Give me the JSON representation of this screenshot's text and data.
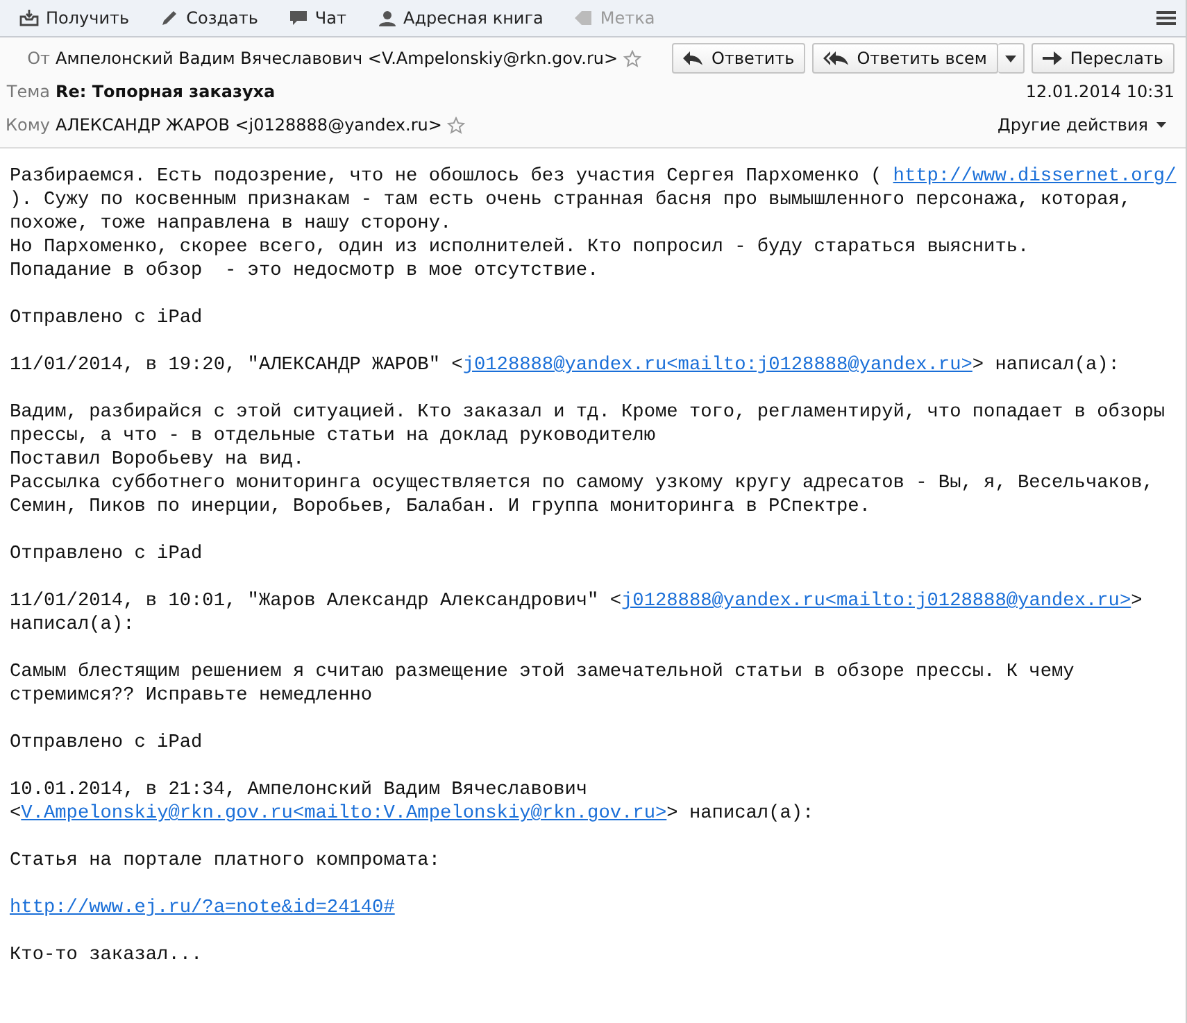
{
  "toolbar": [
    {
      "label": "Получить",
      "kind": "inbox",
      "disabled": false
    },
    {
      "label": "Создать",
      "kind": "pencil",
      "disabled": false
    },
    {
      "label": "Чат",
      "kind": "chat",
      "disabled": false
    },
    {
      "label": "Адресная книга",
      "kind": "person",
      "disabled": false
    },
    {
      "label": "Метка",
      "kind": "tag",
      "disabled": true
    }
  ],
  "header": {
    "fields": [
      {
        "label": "От",
        "value": "Ампелонский Вадим Вячеславович <V.Ampelonskiy@rkn.gov.ru>",
        "kind": "address",
        "bold": false
      },
      {
        "label": "Тема",
        "value": "Re: Топорная заказуха",
        "kind": "subject",
        "bold": true
      },
      {
        "label": "Кому",
        "value": "АЛЕКСАНДР ЖАРОВ <j0128888@yandex.ru>",
        "kind": "address",
        "bold": false
      }
    ],
    "buttons": [
      {
        "label": "Ответить",
        "kind": "reply",
        "dropdown": false
      },
      {
        "label": "Ответить всем",
        "kind": "reply-all",
        "dropdown": true
      },
      {
        "label": "Переслать",
        "kind": "forward",
        "dropdown": false
      }
    ],
    "date": "12.01.2014 10:31",
    "more_actions": "Другие действия"
  },
  "body": [
    [
      [
        {
          "kind": "text",
          "text": "Разбираемся. Есть подозрение, что не обошлось без участия Сергея Пархоменко ( "
        },
        {
          "kind": "link",
          "text": "http://www.dissernet.org/"
        }
      ],
      [
        {
          "kind": "text",
          "text": "). Сужу по косвенным признакам - там есть очень странная басня про вымышленного персонажа, которая,"
        }
      ],
      [
        {
          "kind": "text",
          "text": "похоже, тоже направлена в нашу сторону."
        }
      ],
      [
        {
          "kind": "text",
          "text": "Но Пархоменко, скорее всего, один из исполнителей. Кто попросил - буду стараться выяснить."
        }
      ],
      [
        {
          "kind": "text",
          "text": "Попадание в обзор  - это недосмотр в мое отсутствие."
        }
      ]
    ],
    [
      [
        {
          "kind": "text",
          "text": "Отправлено с iPad"
        }
      ]
    ],
    [
      [
        {
          "kind": "text",
          "text": "11/01/2014, в 19:20, \"АЛЕКСАНДР ЖАРОВ\" <"
        },
        {
          "kind": "link",
          "text": "j0128888@yandex.ru<mailto:j0128888@yandex.ru>"
        },
        {
          "kind": "text",
          "text": "> написал(а):"
        }
      ]
    ],
    [
      [
        {
          "kind": "text",
          "text": "Вадим, разбирайся с этой ситуацией. Кто заказал и тд. Кроме того, регламентируй, что попадает в обзоры"
        }
      ],
      [
        {
          "kind": "text",
          "text": "прессы, а что - в отдельные статьи на доклад руководителю"
        }
      ],
      [
        {
          "kind": "text",
          "text": "Поставил Воробьеву на вид."
        }
      ],
      [
        {
          "kind": "text",
          "text": "Рассылка субботнего мониторинга осуществляется по самому узкому кругу адресатов - Вы, я, Весельчаков,"
        }
      ],
      [
        {
          "kind": "text",
          "text": "Семин, Пиков по инерции, Воробьев, Балабан. И группа мониторинга в РСпектре."
        }
      ]
    ],
    [
      [
        {
          "kind": "text",
          "text": "Отправлено с iPad"
        }
      ]
    ],
    [
      [
        {
          "kind": "text",
          "text": "11/01/2014, в 10:01, \"Жаров Александр Александрович\" <"
        },
        {
          "kind": "link",
          "text": "j0128888@yandex.ru<mailto:j0128888@yandex.ru>"
        },
        {
          "kind": "text",
          "text": ">"
        }
      ],
      [
        {
          "kind": "text",
          "text": "написал(а):"
        }
      ]
    ],
    [
      [
        {
          "kind": "text",
          "text": "Самым блестящим решением я считаю размещение этой замечательной статьи в обзоре прессы. К чему"
        }
      ],
      [
        {
          "kind": "text",
          "text": "стремимся?? Исправьте немедленно"
        }
      ]
    ],
    [
      [
        {
          "kind": "text",
          "text": "Отправлено с iPad"
        }
      ]
    ],
    [
      [
        {
          "kind": "text",
          "text": "10.01.2014, в 21:34, Ампелонский Вадим Вячеславович"
        }
      ],
      [
        {
          "kind": "text",
          "text": "<"
        },
        {
          "kind": "link",
          "text": "V.Ampelonskiy@rkn.gov.ru<mailto:V.Ampelonskiy@rkn.gov.ru>"
        },
        {
          "kind": "text",
          "text": "> написал(а):"
        }
      ]
    ],
    [
      [
        {
          "kind": "text",
          "text": "Статья на портале платного компромата:"
        }
      ]
    ],
    [
      [
        {
          "kind": "link",
          "text": "http://www.ej.ru/?a=note&id=24140#"
        }
      ]
    ],
    [
      [
        {
          "kind": "text",
          "text": "Кто-то заказал..."
        }
      ]
    ]
  ]
}
